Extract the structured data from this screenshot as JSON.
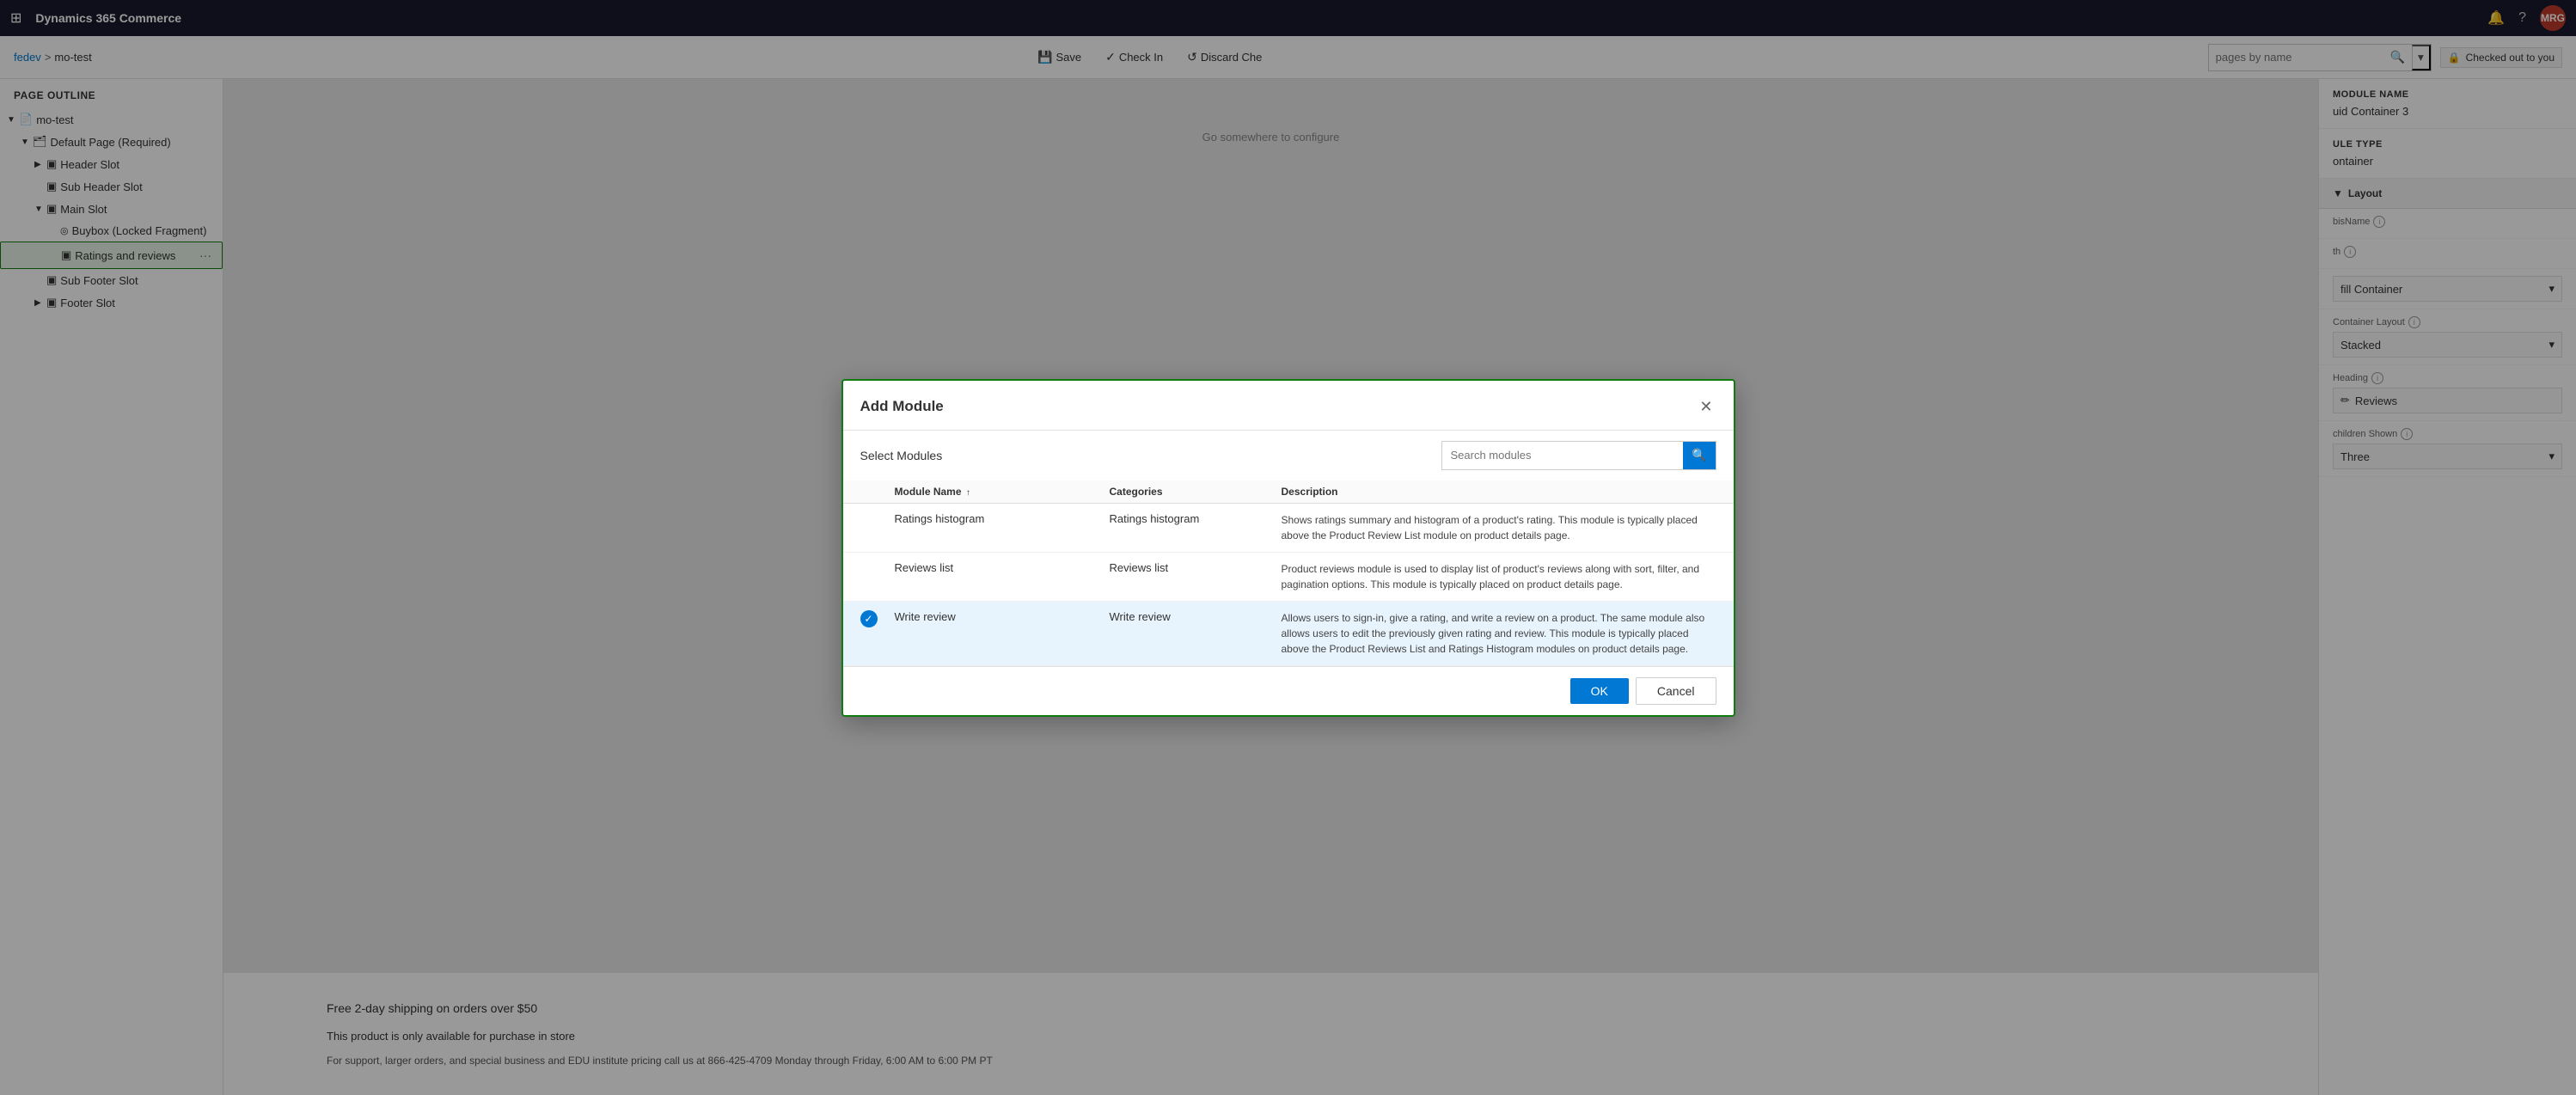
{
  "topNav": {
    "appTitle": "Dynamics 365 Commerce",
    "icons": {
      "grid": "⊞",
      "bell": "🔔",
      "help": "?",
      "avatar": "MRG"
    }
  },
  "toolbar": {
    "breadcrumb": {
      "env": "fedev",
      "separator": ">",
      "page": "mo-test"
    },
    "buttons": {
      "save": "Save",
      "checkIn": "Check In",
      "discard": "Discard Che"
    },
    "searchPlaceholder": "pages by name",
    "checkedOut": "Checked out to you"
  },
  "sidebar": {
    "title": "Page Outline",
    "tree": [
      {
        "id": "mo-test",
        "label": "mo-test",
        "level": 0,
        "hasArrow": true,
        "open": true,
        "icon": "📄"
      },
      {
        "id": "default-page",
        "label": "Default Page (Required)",
        "level": 1,
        "hasArrow": true,
        "open": true,
        "icon": "🗂"
      },
      {
        "id": "header-slot",
        "label": "Header Slot",
        "level": 2,
        "hasArrow": true,
        "open": false,
        "icon": "▣"
      },
      {
        "id": "sub-header-slot",
        "label": "Sub Header Slot",
        "level": 2,
        "hasArrow": false,
        "open": false,
        "icon": "▣"
      },
      {
        "id": "main-slot",
        "label": "Main Slot",
        "level": 2,
        "hasArrow": true,
        "open": true,
        "icon": "▣"
      },
      {
        "id": "buybox",
        "label": "Buybox (Locked Fragment)",
        "level": 3,
        "hasArrow": false,
        "open": false,
        "icon": "◎"
      },
      {
        "id": "ratings-reviews",
        "label": "Ratings and reviews",
        "level": 3,
        "hasArrow": false,
        "open": false,
        "icon": "▣",
        "highlighted": true
      },
      {
        "id": "sub-footer-slot",
        "label": "Sub Footer Slot",
        "level": 2,
        "hasArrow": false,
        "open": false,
        "icon": "▣"
      },
      {
        "id": "footer-slot",
        "label": "Footer Slot",
        "level": 2,
        "hasArrow": true,
        "open": false,
        "icon": "▣"
      }
    ]
  },
  "rightPanel": {
    "moduleNameLabel": "MODULE NAME",
    "moduleNameValue": "uid Container 3",
    "moduleTypeLabel": "ule Type",
    "moduleTypeValue": "ontainer",
    "layoutSection": "Layout",
    "properties": [
      {
        "id": "bisName",
        "label": "bisName",
        "hasInfo": true,
        "value": ""
      },
      {
        "id": "th",
        "label": "th",
        "hasInfo": true,
        "value": ""
      },
      {
        "id": "fillContainer",
        "label": "",
        "value": "fill Container"
      },
      {
        "id": "containerLayout",
        "label": "Container Layout",
        "hasInfo": true,
        "value": "Stacked"
      },
      {
        "id": "heading",
        "label": "Heading",
        "hasInfo": true,
        "value": "Reviews",
        "hasEdit": true
      },
      {
        "id": "childrenShown",
        "label": "children Shown",
        "hasInfo": true,
        "value": "Three"
      }
    ]
  },
  "modal": {
    "title": "Add Module",
    "selectLabel": "Select Modules",
    "searchPlaceholder": "Search modules",
    "tableHeaders": [
      "",
      "Module Name",
      "Categories",
      "Description"
    ],
    "modules": [
      {
        "id": "ratings-histogram",
        "name": "Ratings histogram",
        "category": "Ratings histogram",
        "description": "Shows ratings summary and histogram of a product's rating. This module is typically placed above the Product Review List module on product details page.",
        "selected": false
      },
      {
        "id": "reviews-list",
        "name": "Reviews list",
        "category": "Reviews list",
        "description": "Product reviews module is used to display list of product's reviews along with sort, filter, and pagination options. This module is typically placed on product details page.",
        "selected": false
      },
      {
        "id": "write-review",
        "name": "Write review",
        "category": "Write review",
        "description": "Allows users to sign-in, give a rating, and write a review on a product. The same module also allows users to edit the previously given rating and review. This module is typically placed above the Product Reviews List and Ratings Histogram modules on product details page.",
        "selected": true
      }
    ],
    "buttons": {
      "ok": "OK",
      "cancel": "Cancel"
    }
  },
  "pageContent": {
    "configureBanner": "Go somewhere to configure",
    "shipping": "Free 2-day shipping on orders over $50",
    "availability": "This product is only available for purchase in store",
    "support": "For support, larger orders, and special business and EDU institute pricing call us at 866-425-4709 Monday through Friday, 6:00 AM to 6:00 PM PT"
  }
}
